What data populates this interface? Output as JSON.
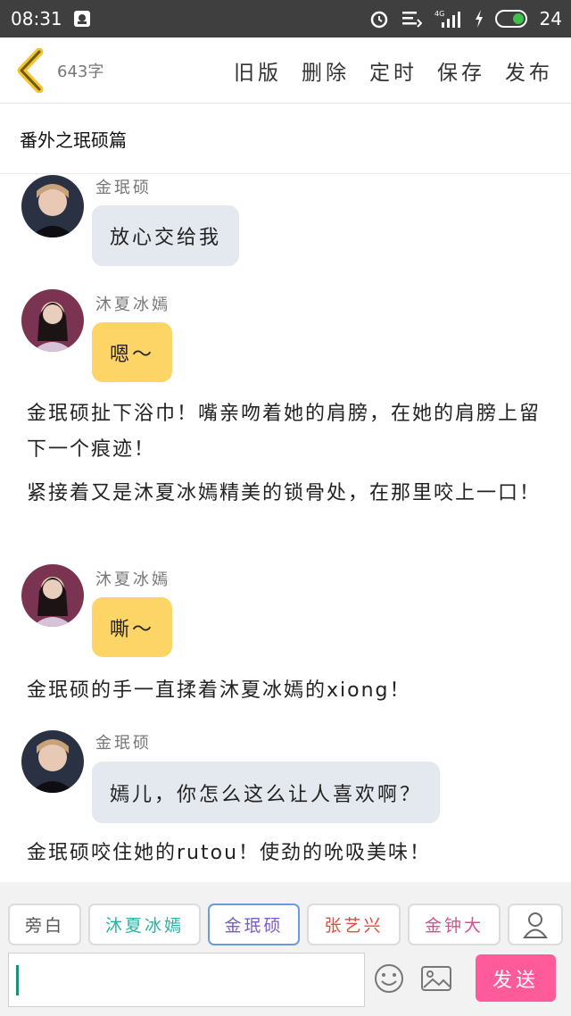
{
  "status_bar": {
    "time": "08:31",
    "battery": "24",
    "network": "4G"
  },
  "nav": {
    "word_count": "643字",
    "actions": [
      "旧版",
      "删除",
      "定时",
      "保存",
      "发布"
    ]
  },
  "title": "番外之珉硕篇",
  "messages": [
    {
      "speaker": "金珉硕",
      "text": "放心交给我",
      "style": "grey"
    },
    {
      "speaker": "沐夏冰嫣",
      "text": "嗯～",
      "style": "yellow"
    },
    {
      "narration": "金珉硕扯下浴巾！嘴亲吻着她的肩膀，在她的肩膀上留下一个痕迹！"
    },
    {
      "narration": "紧接着又是沐夏冰嫣精美的锁骨处，在那里咬上一口！"
    },
    {
      "speaker": "沐夏冰嫣",
      "text": "嘶～",
      "style": "yellow"
    },
    {
      "narration": "金珉硕的手一直揉着沐夏冰嫣的xiong！"
    },
    {
      "speaker": "金珉硕",
      "text": "嫣儿，你怎么这么让人喜欢啊？",
      "style": "grey"
    },
    {
      "narration": "金珉硕咬住她的rutou！使劲的吮吸美味！"
    }
  ],
  "characters": [
    {
      "label": "旁白",
      "color": "#555555"
    },
    {
      "label": "沐夏冰嫣",
      "color": "#27b3a4"
    },
    {
      "label": "金珉硕",
      "color": "#7a5cc8"
    },
    {
      "label": "张艺兴",
      "color": "#e04c3c"
    },
    {
      "label": "金钟大",
      "color": "#d94e8c"
    }
  ],
  "composer": {
    "input_value": "",
    "send_label": "发送"
  }
}
